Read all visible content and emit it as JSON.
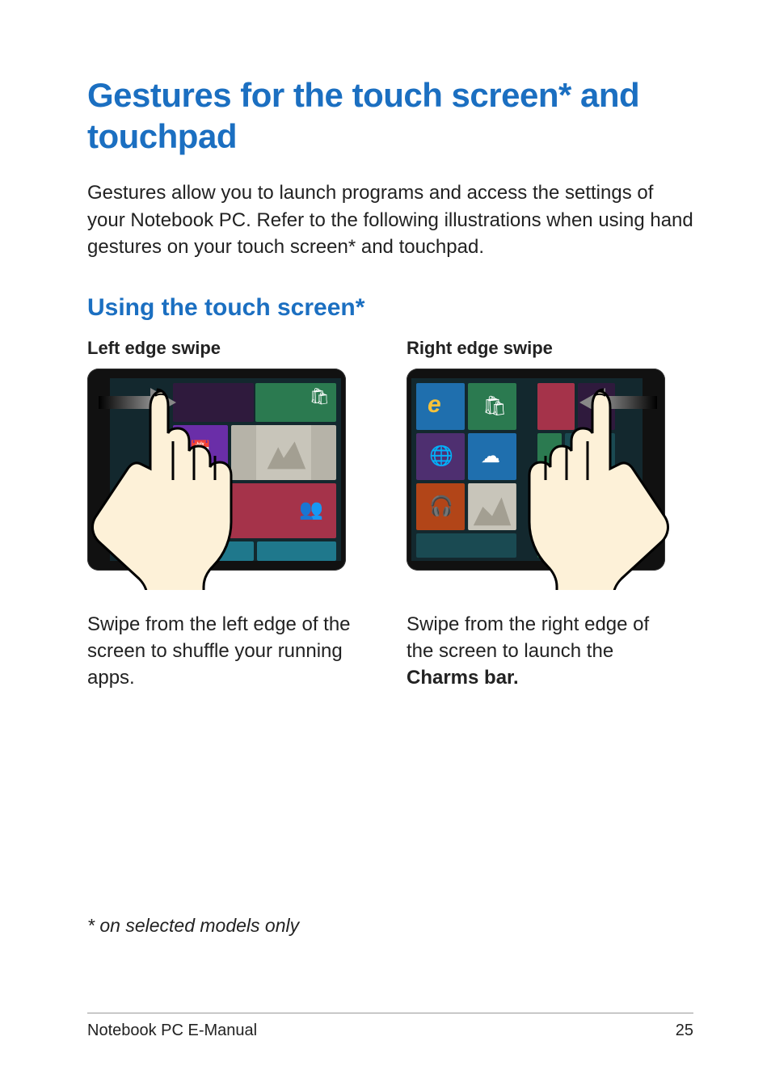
{
  "title": "Gestures for the touch screen* and touchpad",
  "intro": "Gestures allow you to launch programs and access the settings of your Notebook PC. Refer to the following illustrations when using hand gestures on your touch screen* and touchpad.",
  "section_heading": "Using the touch screen*",
  "left": {
    "heading": "Left edge swipe",
    "desc_pre": "Swipe from the left edge of the screen to shuffle your running apps."
  },
  "right": {
    "heading": "Right edge swipe",
    "desc_pre": "Swipe from the right edge of the screen to launch the ",
    "desc_bold": "Charms bar."
  },
  "footnote": "* on selected models only",
  "footer": {
    "doc": "Notebook PC E-Manual",
    "page": "25"
  }
}
